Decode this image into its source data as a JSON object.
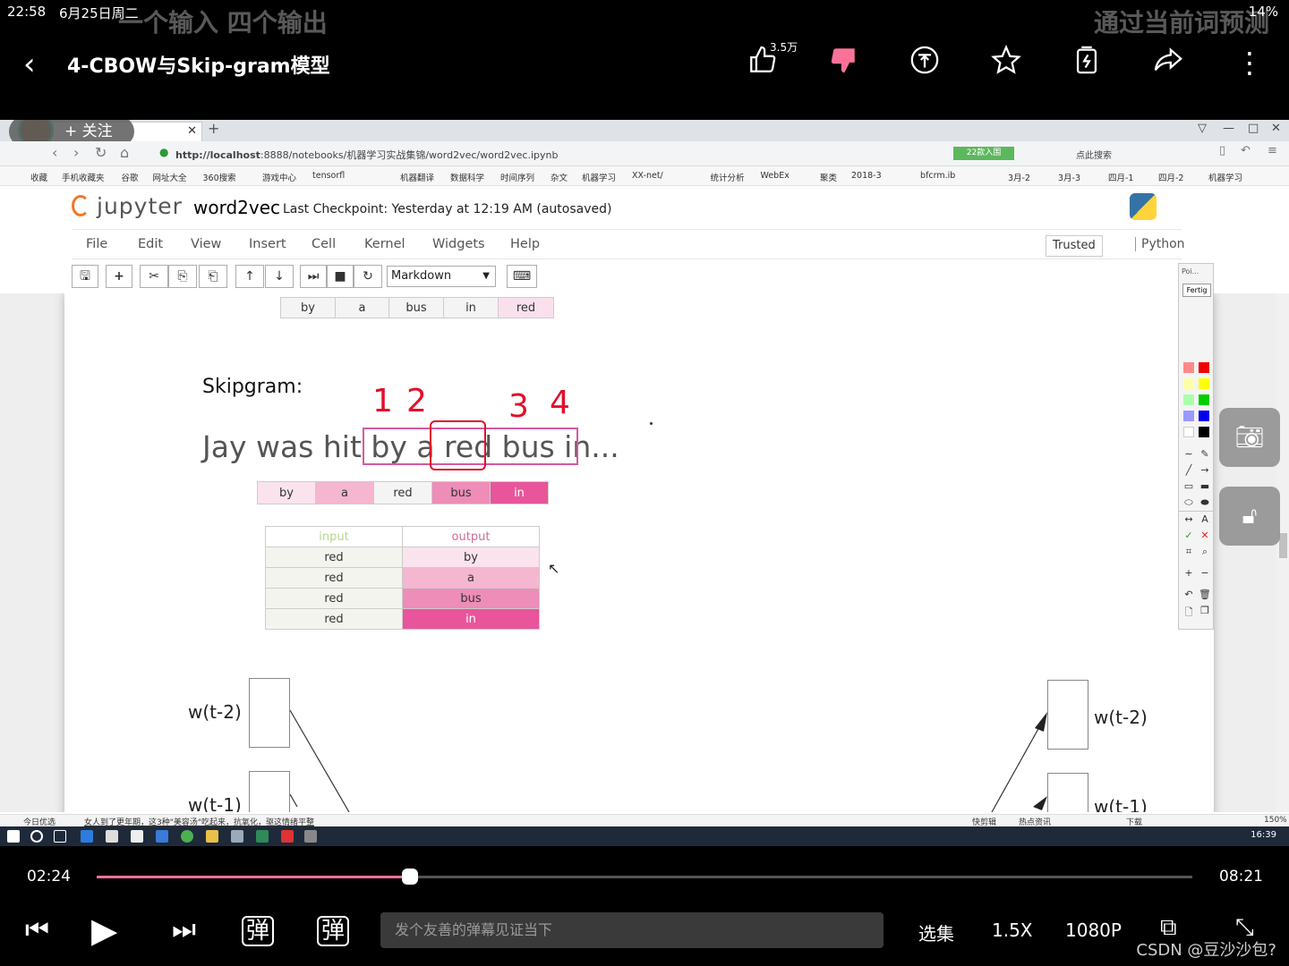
{
  "status": {
    "time": "22:58",
    "date": "6月25日周二",
    "battery": "14%",
    "ghost_left": "一个输入 四个输出",
    "ghost_right": "通过当前词预测"
  },
  "video": {
    "title": "4-CBOW与Skip-gram模型",
    "like_count": "3.5万",
    "current_time": "02:24",
    "total_time": "08:21",
    "progress": 0.286,
    "danmaku_placeholder": "发个友善的弹幕见证当下",
    "episodes_label": "选集",
    "speed_label": "1.5X",
    "quality_label": "1080P",
    "watermark": "CSDN @豆沙沙包?"
  },
  "uploader": {
    "follow_label": "+ 关注"
  },
  "browser": {
    "url_host": "http://localhost",
    "url_rest": ":8888/notebooks/机器学习实战集锦/word2vec/word2vec.ipynb",
    "badge": "22款入围",
    "search_hint": "点此搜索",
    "bookmarks": [
      "收藏",
      "手机收藏夹",
      "谷歌",
      "网址大全",
      "360搜索",
      "游戏中心",
      "tensorfl",
      "机器翻译",
      "数据科学",
      "时间序列",
      "杂文",
      "机器学习",
      "XX-net/",
      "统计分析",
      "WebEx",
      "聚类",
      "2018-3",
      "bfcrm.ib",
      "3月-2",
      "3月-3",
      "四月-1",
      "四月-2",
      "机器学习"
    ]
  },
  "jupyter": {
    "logo": "jupyter",
    "notebook_name": "word2vec",
    "checkpoint": "Last Checkpoint: Yesterday at 12:19 AM (autosaved)",
    "menu": [
      "File",
      "Edit",
      "View",
      "Insert",
      "Cell",
      "Kernel",
      "Widgets",
      "Help"
    ],
    "trusted": "Trusted",
    "kernel": "Python",
    "cell_type": "Markdown"
  },
  "content": {
    "top_words": [
      "by",
      "a",
      "bus",
      "in",
      "red"
    ],
    "heading": "Skipgram:",
    "sentence": "Jay was hit by a red bus in...",
    "annotations": [
      "1",
      "2",
      "3",
      "4"
    ],
    "window_words": [
      "by",
      "a",
      "red",
      "bus",
      "in"
    ],
    "io_table": {
      "headers": [
        "input",
        "output"
      ],
      "rows": [
        [
          "red",
          "by"
        ],
        [
          "red",
          "a"
        ],
        [
          "red",
          "bus"
        ],
        [
          "red",
          "in"
        ]
      ]
    },
    "nn_labels": [
      "w(t-2)",
      "w(t-1)",
      "w(t-2)",
      "w(t-1)"
    ]
  },
  "palette": {
    "title": "Poi...",
    "done": "Fertig"
  },
  "statusline": {
    "left": "今日优选",
    "news": "女人到了更年期，这3种\"美容汤\"吃起来，抗氧化，驱这情绪平整",
    "right": [
      "快剪辑",
      "热点资讯",
      "下载"
    ],
    "zoom": "150%"
  },
  "taskbar": {
    "time": "16:39"
  }
}
